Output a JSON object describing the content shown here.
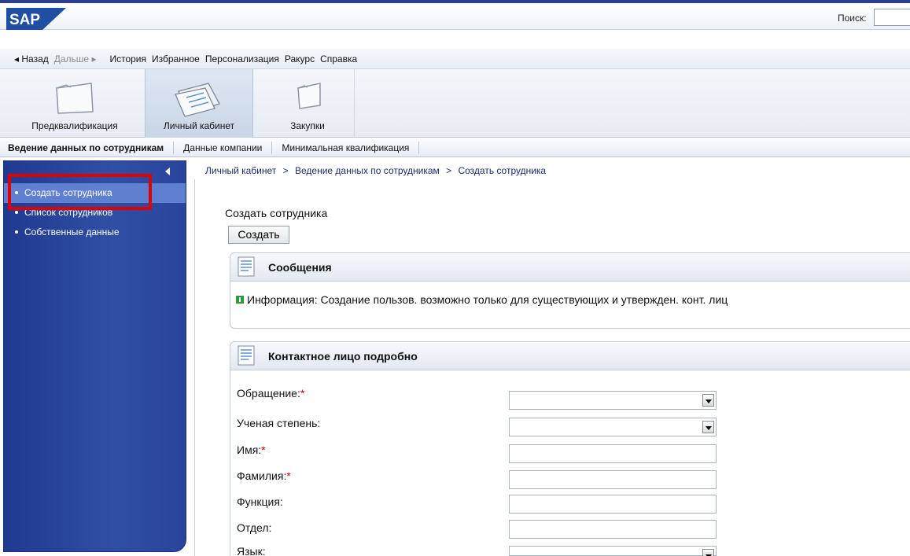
{
  "header": {
    "logo_text": "SAP",
    "search_label": "Поиск:",
    "search_value": ""
  },
  "nav": {
    "back": "◂ Назад",
    "forward": "Дальше ▸",
    "items": [
      "История",
      "Избранное",
      "Персонализация",
      "Ракурс",
      "Справка"
    ]
  },
  "tabs": [
    {
      "label": "Предквалификация",
      "icon": "folder-icon",
      "active": false
    },
    {
      "label": "Личный кабинет",
      "icon": "documents-icon",
      "active": true
    },
    {
      "label": "Закупки",
      "icon": "folder-icon",
      "active": false
    }
  ],
  "subtabs": [
    {
      "label": "Ведение данных по сотрудникам",
      "active": true
    },
    {
      "label": "Данные компании",
      "active": false
    },
    {
      "label": "Минимальная квалификация",
      "active": false
    }
  ],
  "sidebar": {
    "items": [
      {
        "label": "Создать сотрудника",
        "selected": true
      },
      {
        "label": "Список сотрудников",
        "selected": false
      },
      {
        "label": "Собственные данные",
        "selected": false
      }
    ]
  },
  "breadcrumb": {
    "items": [
      "Личный кабинет",
      "Ведение данных по сотрудникам",
      "Создать сотрудника"
    ],
    "separator": ">"
  },
  "page": {
    "title": "Создать сотрудника",
    "create_button": "Создать"
  },
  "messages_panel": {
    "title": "Сообщения",
    "info_text": "Информация: Создание пользов. возможно только для существующих и утвержден. конт. лиц"
  },
  "contact_panel": {
    "title": "Контактное лицо подробно",
    "fields": [
      {
        "label": "Обращение:",
        "required": true,
        "type": "select",
        "value": ""
      },
      {
        "label": "Ученая степень:",
        "required": false,
        "type": "select",
        "value": ""
      },
      {
        "label": "Имя:",
        "required": true,
        "type": "text",
        "value": ""
      },
      {
        "label": "Фамилия:",
        "required": true,
        "type": "text",
        "value": ""
      },
      {
        "label": "Функция:",
        "required": false,
        "type": "text",
        "value": ""
      },
      {
        "label": "Отдел:",
        "required": false,
        "type": "text",
        "value": ""
      },
      {
        "label": "Язык:",
        "required": false,
        "type": "select",
        "value": ""
      }
    ],
    "required_mark": "*"
  },
  "colors": {
    "sidebar": "#2f4fa5",
    "sidebar_selected": "#5f7fd0",
    "highlight": "#e00000",
    "required": "#d00000",
    "info_icon": "#2e9a38"
  }
}
